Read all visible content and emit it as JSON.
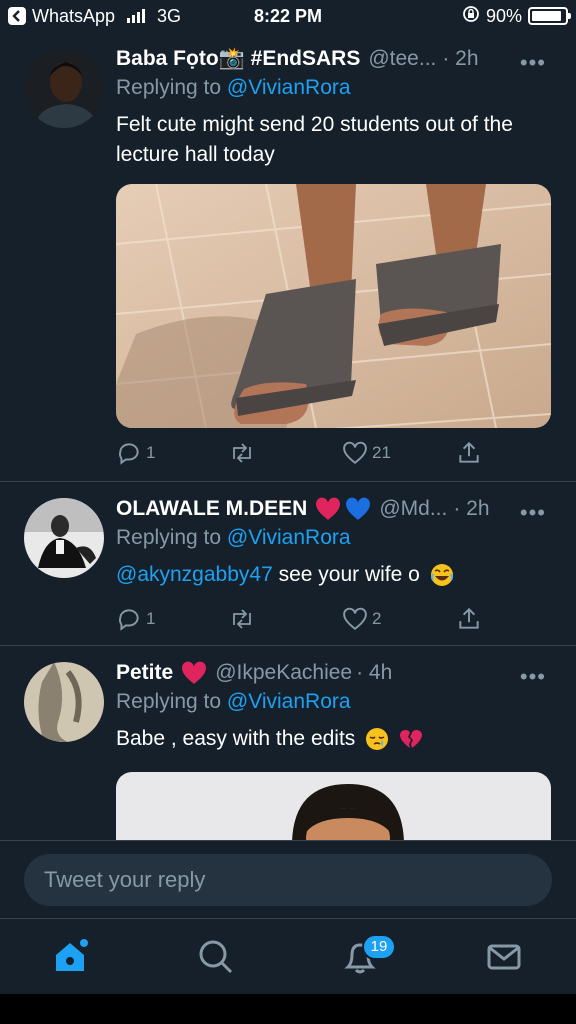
{
  "status_bar": {
    "back_app": "WhatsApp",
    "network": "3G",
    "time": "8:22 PM",
    "battery": "90%",
    "battery_level": 0.9
  },
  "tweets": [
    {
      "name": "Baba Fọto📸 #EndSARS",
      "handle": "@tee...",
      "time": "· 2h",
      "replying_label": "Replying to",
      "replying_to": "@VivianRora",
      "text": "Felt cute might send 20 students out of the lecture hall today",
      "reply_count": "1",
      "retweet_count": "",
      "like_count": "21"
    },
    {
      "name": "OLAWALE M.DEEN",
      "handle": "@Md...",
      "time": "· 2h",
      "replying_label": "Replying to",
      "replying_to": "@VivianRora",
      "mention": "@akynzgabby47",
      "text": " see your wife o",
      "reply_count": "1",
      "retweet_count": "",
      "like_count": "2"
    },
    {
      "name": "Petite",
      "handle": "@IkpeKachiee",
      "time": "· 4h",
      "replying_label": "Replying to",
      "replying_to": "@VivianRora",
      "text": "Babe , easy with the edits"
    }
  ],
  "compose": {
    "placeholder": "Tweet your reply"
  },
  "tabs": {
    "notifications_badge": "19"
  },
  "colors": {
    "background": "#15202b",
    "accent": "#1da1f2",
    "muted": "#8899a6",
    "like_heart": "#e0245e"
  },
  "icons": [
    "back-icon",
    "signal-icon",
    "lock-rotation-icon",
    "battery-icon",
    "more-icon",
    "reply-icon",
    "retweet-icon",
    "like-icon",
    "share-icon",
    "home-icon",
    "search-icon",
    "notifications-icon",
    "messages-icon"
  ]
}
